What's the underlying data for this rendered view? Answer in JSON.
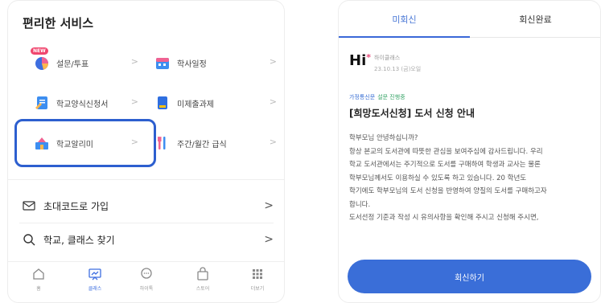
{
  "left": {
    "title": "편리한 서비스",
    "badge_new": "NEW",
    "services": [
      {
        "label": "설문/투표",
        "icon": "pie-chart-icon"
      },
      {
        "label": "학사일정",
        "icon": "calendar-icon"
      },
      {
        "label": "학교양식신청서",
        "icon": "form-document-icon"
      },
      {
        "label": "미제출과제",
        "icon": "assignment-icon"
      },
      {
        "label": "학교알리미",
        "icon": "school-alert-icon"
      },
      {
        "label": "주간/월간 급식",
        "icon": "meal-utensils-icon"
      }
    ],
    "rows": [
      {
        "label": "초대코드로 가입",
        "icon": "envelope-icon"
      },
      {
        "label": "학교, 클래스 찾기",
        "icon": "search-icon"
      }
    ],
    "chevron": ">",
    "tabs": [
      {
        "label": "홈",
        "icon": "home-icon"
      },
      {
        "label": "클래스",
        "icon": "class-icon"
      },
      {
        "label": "하이톡",
        "icon": "chat-icon"
      },
      {
        "label": "스토어",
        "icon": "store-bag-icon"
      },
      {
        "label": "더보기",
        "icon": "more-grid-icon"
      }
    ],
    "active_tab": 1
  },
  "right": {
    "tabs": [
      "미회신",
      "회신완료"
    ],
    "logo_text": "Hi",
    "logo_accent": "*",
    "sender": "하이클래스",
    "sent_date": "23.10.13 (금)오일",
    "category": "가정통신문",
    "status": "설문 진행중",
    "title": "[희망도서신청] 도서 신청 안내",
    "body_lines": [
      "학부모님 안녕하십니까?",
      "항상 본교의 도서관에 따뜻한 관심을 보여주심에 감사드립니다. 우리",
      "학교 도서관에서는 주기적으로 도서를 구매하여 학생과 교사는 물론",
      "학부모님께서도 이용하실 수 있도록 하고 있습니다. 20  학년도",
      "학기에도 학부모님의 도서 신청을 반영하여 양질의 도서를 구매하고자",
      "합니다.",
      "도서선정 기준과 작성 시 유의사항을 확인해 주시고 신청해 주시면,"
    ],
    "reply_button": "회신하기"
  },
  "colors": {
    "accent_blue": "#3a6ed8",
    "highlight_border": "#2d5fcf",
    "new_badge": "#f0466e"
  }
}
